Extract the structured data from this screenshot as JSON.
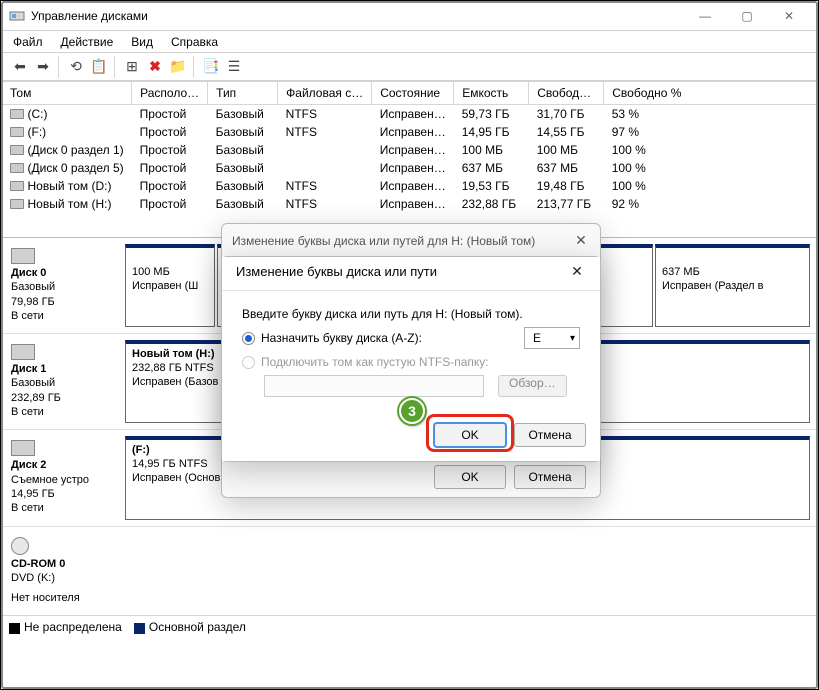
{
  "window": {
    "title": "Управление дисками"
  },
  "menu": {
    "file": "Файл",
    "action": "Действие",
    "view": "Вид",
    "help": "Справка"
  },
  "columns": {
    "vol": "Том",
    "layout": "Располо…",
    "type": "Тип",
    "fs": "Файловая с…",
    "status": "Состояние",
    "capacity": "Емкость",
    "free": "Свобод…",
    "freepct": "Свободно %"
  },
  "rows": [
    {
      "vol": "(C:)",
      "layout": "Простой",
      "type": "Базовый",
      "fs": "NTFS",
      "status": "Исправен…",
      "cap": "59,73 ГБ",
      "free": "31,70 ГБ",
      "pct": "53 %"
    },
    {
      "vol": "(F:)",
      "layout": "Простой",
      "type": "Базовый",
      "fs": "NTFS",
      "status": "Исправен…",
      "cap": "14,95 ГБ",
      "free": "14,55 ГБ",
      "pct": "97 %"
    },
    {
      "vol": "(Диск 0 раздел 1)",
      "layout": "Простой",
      "type": "Базовый",
      "fs": "",
      "status": "Исправен…",
      "cap": "100 МБ",
      "free": "100 МБ",
      "pct": "100 %"
    },
    {
      "vol": "(Диск 0 раздел 5)",
      "layout": "Простой",
      "type": "Базовый",
      "fs": "",
      "status": "Исправен…",
      "cap": "637 МБ",
      "free": "637 МБ",
      "pct": "100 %"
    },
    {
      "vol": "Новый том (D:)",
      "layout": "Простой",
      "type": "Базовый",
      "fs": "NTFS",
      "status": "Исправен…",
      "cap": "19,53 ГБ",
      "free": "19,48 ГБ",
      "pct": "100 %"
    },
    {
      "vol": "Новый том (H:)",
      "layout": "Простой",
      "type": "Базовый",
      "fs": "NTFS",
      "status": "Исправен…",
      "cap": "232,88 ГБ",
      "free": "213,77 ГБ",
      "pct": "92 %"
    }
  ],
  "graph": {
    "disk0": {
      "name": "Диск 0",
      "type": "Базовый",
      "size": "79,98 ГБ",
      "status": "В сети",
      "p1": {
        "size": "100 МБ",
        "status": "Исправен (Ш"
      },
      "p5": {
        "size": "637 МБ",
        "status": "Исправен (Раздел в"
      }
    },
    "disk1": {
      "name": "Диск 1",
      "type": "Базовый",
      "size": "232,89 ГБ",
      "status": "В сети",
      "p1_name": "Новый том  (H:)",
      "p1_size": "232,88 ГБ NTFS",
      "p1_status": "Исправен (Базов"
    },
    "disk2": {
      "name": "Диск 2",
      "type": "Съемное устро",
      "size": "14,95 ГБ",
      "status": "В сети",
      "p1_name": "(F:)",
      "p1_size": "14,95 ГБ NTFS",
      "p1_status": "Исправен (Основной раздел)"
    },
    "cd": {
      "name": "CD-ROM 0",
      "sub": "DVD (K:)",
      "status": "Нет носителя"
    }
  },
  "legend": {
    "unalloc": "Не распределена",
    "primary": "Основной раздел"
  },
  "dlg_back": {
    "title": "Изменение буквы диска или путей для H: (Новый том)",
    "ok": "OK",
    "cancel": "Отмена"
  },
  "dlg_front": {
    "title": "Изменение буквы диска или пути",
    "prompt": "Введите букву диска или путь для H: (Новый том).",
    "opt1": "Назначить букву диска (A-Z):",
    "opt2": "Подключить том как пустую NTFS-папку:",
    "letter": "E",
    "browse": "Обзор…",
    "ok": "OK",
    "cancel": "Отмена"
  },
  "step": "3"
}
